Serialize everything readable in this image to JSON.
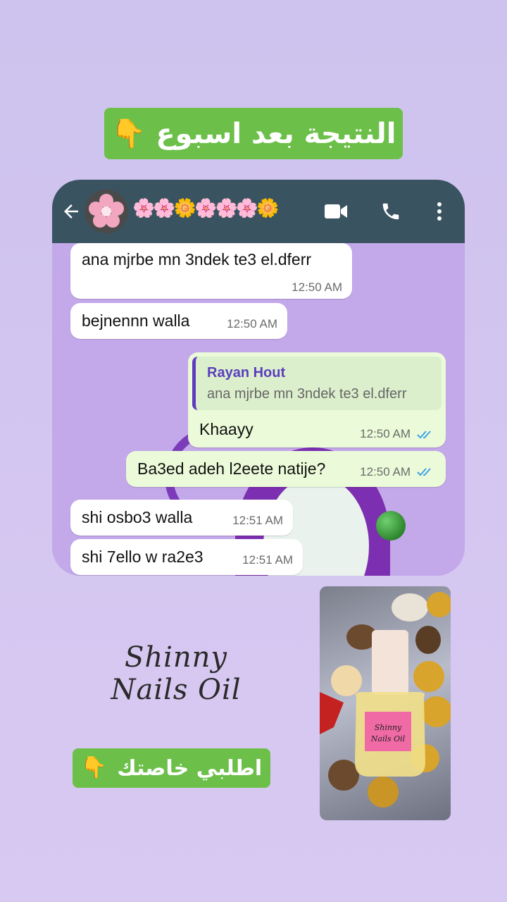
{
  "top_banner": {
    "text": "النتيجة بعد اسبوع",
    "icon": "pointing-down-hand-icon"
  },
  "chat_header": {
    "contact_name": "🌸🌸🌼🌸🌸🌸🌼",
    "colors": {
      "header": "#3a5360"
    }
  },
  "messages": [
    {
      "direction": "in",
      "text": "ana mjrbe mn 3ndek te3 el.dferr",
      "time": "12:50 AM"
    },
    {
      "direction": "in",
      "text": "bejnennn walla",
      "time": "12:50 AM"
    },
    {
      "direction": "out",
      "reply_to": {
        "name": "Rayan Hout",
        "text": "ana mjrbe mn 3ndek te3 el.dferr"
      },
      "text": "Khaayy",
      "time": "12:50 AM",
      "status": "read"
    },
    {
      "direction": "out",
      "text": "Ba3ed adeh l2eete natije?",
      "time": "12:50 AM",
      "status": "read"
    },
    {
      "direction": "in",
      "text": "shi osbo3 walla",
      "time": "12:51 AM"
    },
    {
      "direction": "in",
      "text": "shi 7ello w ra2e3",
      "time": "12:51 AM"
    }
  ],
  "brand": {
    "line1": "Shinny",
    "line2": "Nails Oil"
  },
  "bottom_banner": {
    "text": "اطلبي خاصتك",
    "icon": "pointing-down-hand-icon"
  },
  "product_image": {
    "label_line1": "Shinny",
    "label_line2": "Nails Oil"
  },
  "colors": {
    "banner_green": "#6cc04a",
    "incoming_bubble": "#ffffff",
    "outgoing_bubble": "#ebfbd9",
    "read_ticks": "#3fa2e8"
  }
}
